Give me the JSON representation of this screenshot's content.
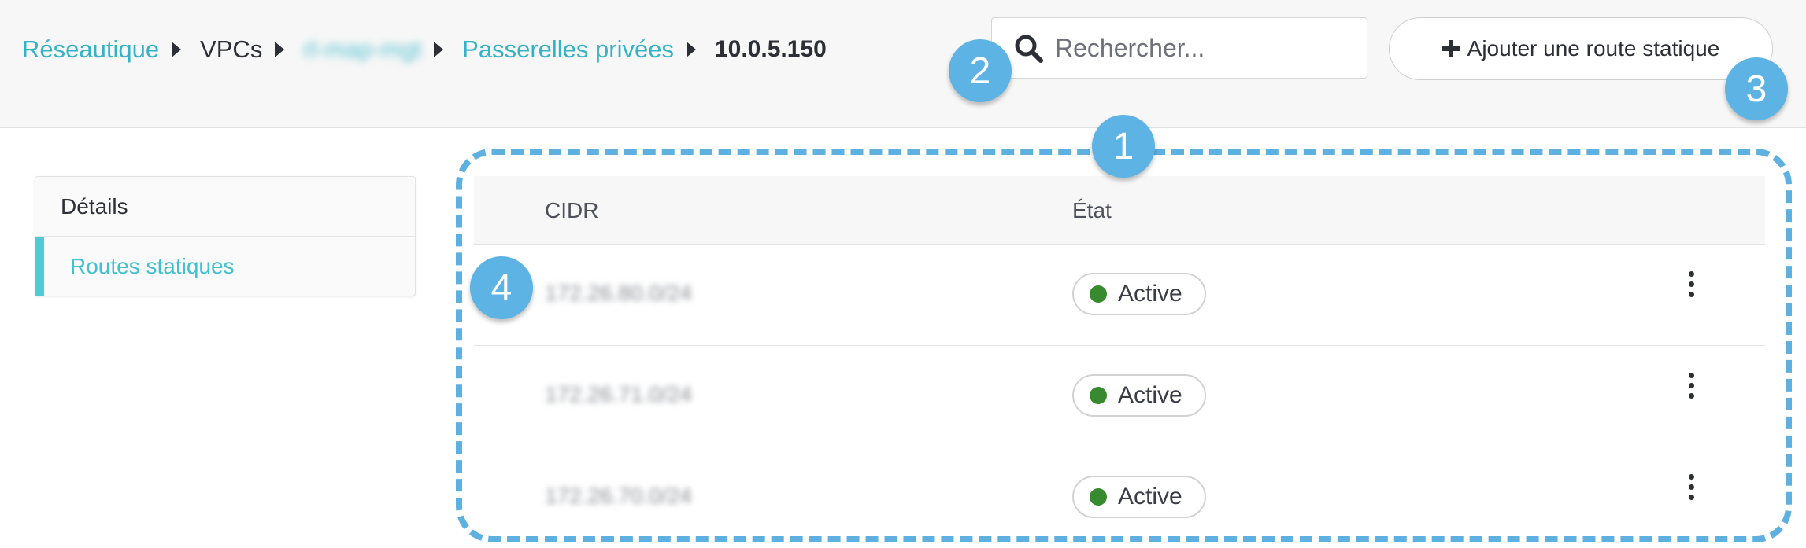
{
  "breadcrumb": {
    "items": [
      {
        "label": "Réseautique"
      },
      {
        "label": "VPCs"
      },
      {
        "label": "rl-map-mgt"
      },
      {
        "label": "Passerelles privées"
      },
      {
        "label": "10.0.5.150"
      }
    ]
  },
  "search": {
    "placeholder": "Rechercher..."
  },
  "toolbar": {
    "add_label": "Ajouter une route statique"
  },
  "sidebar": {
    "items": [
      {
        "label": "Détails"
      },
      {
        "label": "Routes statiques"
      }
    ]
  },
  "table": {
    "columns": [
      "CIDR",
      "État"
    ],
    "rows": [
      {
        "cidr": "172.26.80.0/24",
        "status": "Active"
      },
      {
        "cidr": "172.26.71.0/24",
        "status": "Active"
      },
      {
        "cidr": "172.26.70.0/24",
        "status": "Active"
      }
    ]
  },
  "callouts": [
    "1",
    "2",
    "3",
    "4"
  ],
  "colors": {
    "link": "#35b3c6",
    "active_nav": "#4fcad6",
    "status_active": "#378a2e",
    "callout": "#5db3e4"
  }
}
